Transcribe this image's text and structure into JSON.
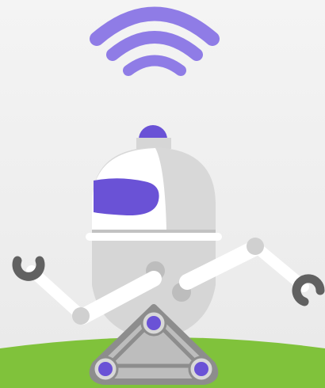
{
  "scene": {
    "subject": "robot-illustration",
    "elements": [
      "wifi-signal-icon",
      "robot-head-cap",
      "robot-body",
      "robot-visor",
      "robot-arms",
      "robot-claws",
      "triangular-wheel-base",
      "grass-ground"
    ]
  },
  "colors": {
    "background_top": "#f2f2f2",
    "background_bottom": "#e9e9e9",
    "accent_purple": "#6a52d6",
    "wifi_purple": "#8f7ce6",
    "robot_body": "#d8d8d8",
    "robot_shadow": "#c7c7c7",
    "robot_white": "#ffffff",
    "outline_gray": "#8d8d8d",
    "claw_gray": "#616161",
    "ground_green": "#80c23b"
  }
}
